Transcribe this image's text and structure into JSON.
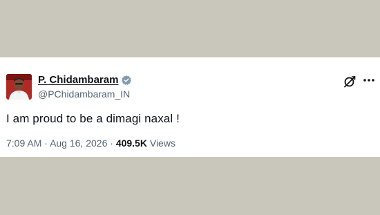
{
  "tweet": {
    "display_name": "P. Chidambaram",
    "handle": "@PChidambaram_IN",
    "text": "I am proud to be a dimagi naxal !",
    "time": "7:09 AM",
    "separator": "·",
    "date": "Aug 16, 2026",
    "views_count": "409.5K",
    "views_label": "Views"
  },
  "icons": {
    "verified": "verified-badge-icon",
    "grok": "grok-icon",
    "more": "more-options-icon"
  },
  "colors": {
    "page_background": "#c9c7bc",
    "card_background": "#ffffff",
    "primary_text": "#0f1419",
    "secondary_text": "#536471",
    "verified_badge": "#829aab"
  }
}
